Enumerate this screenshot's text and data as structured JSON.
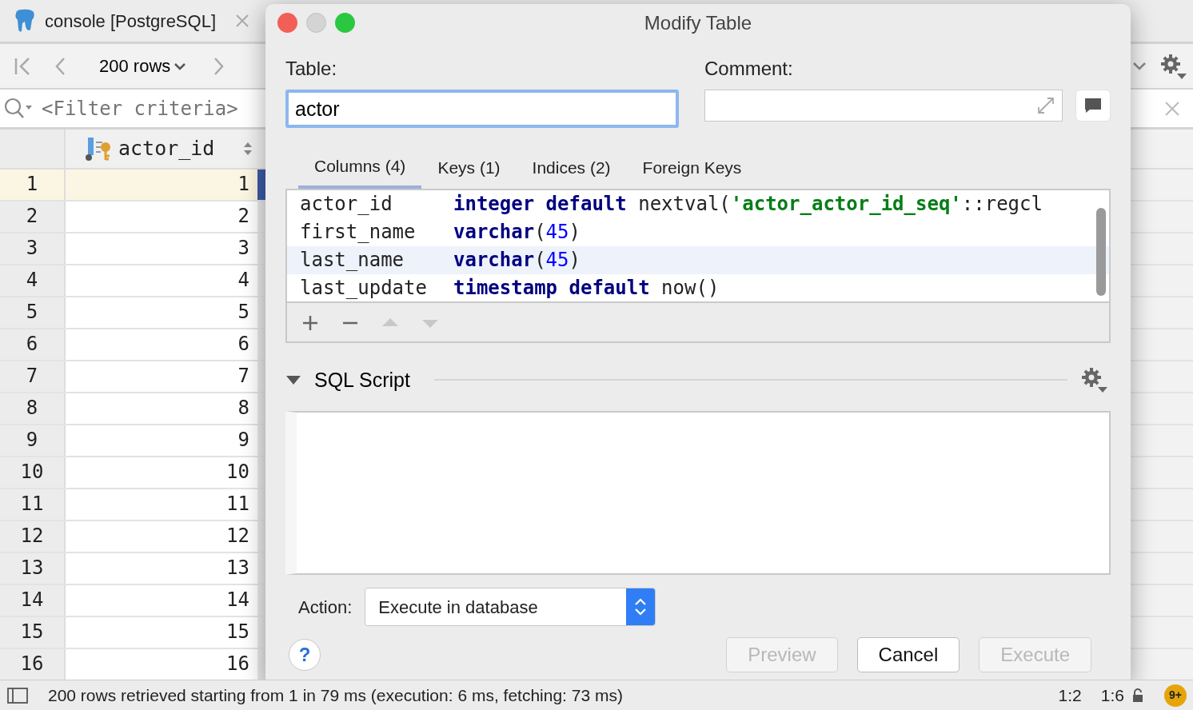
{
  "editor_tab": {
    "title": "console [PostgreSQL]"
  },
  "toolbar": {
    "page_size": "200 rows"
  },
  "filter": {
    "placeholder": "<Filter criteria>"
  },
  "grid": {
    "column": "actor_id",
    "rows": [
      {
        "number": "1",
        "value": "1",
        "selected": true
      },
      {
        "number": "2",
        "value": "2",
        "selected": false
      },
      {
        "number": "3",
        "value": "3",
        "selected": false
      },
      {
        "number": "4",
        "value": "4",
        "selected": false
      },
      {
        "number": "5",
        "value": "5",
        "selected": false
      },
      {
        "number": "6",
        "value": "6",
        "selected": false
      },
      {
        "number": "7",
        "value": "7",
        "selected": false
      },
      {
        "number": "8",
        "value": "8",
        "selected": false
      },
      {
        "number": "9",
        "value": "9",
        "selected": false
      },
      {
        "number": "10",
        "value": "10",
        "selected": false
      },
      {
        "number": "11",
        "value": "11",
        "selected": false
      },
      {
        "number": "12",
        "value": "12",
        "selected": false
      },
      {
        "number": "13",
        "value": "13",
        "selected": false
      },
      {
        "number": "14",
        "value": "14",
        "selected": false
      },
      {
        "number": "15",
        "value": "15",
        "selected": false
      },
      {
        "number": "16",
        "value": "16",
        "selected": false
      }
    ]
  },
  "status_bar": {
    "message": "200 rows retrieved starting from 1 in 79 ms (execution: 6 ms, fetching: 73 ms)",
    "position": "1:2",
    "selection": "1:6",
    "notifications": "9+"
  },
  "dialog": {
    "title": "Modify Table",
    "table_label": "Table:",
    "table_name": "actor",
    "comment_label": "Comment:",
    "tabs": [
      {
        "label": "Columns (4)",
        "selected": true
      },
      {
        "label": "Keys (1)",
        "selected": false
      },
      {
        "label": "Indices (2)",
        "selected": false
      },
      {
        "label": "Foreign Keys",
        "selected": false
      }
    ],
    "columns": [
      {
        "name": "actor_id",
        "selected": false,
        "definition": [
          {
            "text": "integer default",
            "kind": "keyword"
          },
          {
            "text": " nextval(",
            "kind": "plain"
          },
          {
            "text": "'actor_actor_id_seq'",
            "kind": "string"
          },
          {
            "text": "::regcl",
            "kind": "plain"
          }
        ]
      },
      {
        "name": "first_name",
        "selected": false,
        "definition": [
          {
            "text": "varchar",
            "kind": "keyword"
          },
          {
            "text": "(",
            "kind": "plain"
          },
          {
            "text": "45",
            "kind": "number"
          },
          {
            "text": ")",
            "kind": "plain"
          }
        ]
      },
      {
        "name": "last_name",
        "selected": true,
        "definition": [
          {
            "text": "varchar",
            "kind": "keyword"
          },
          {
            "text": "(",
            "kind": "plain"
          },
          {
            "text": "45",
            "kind": "number"
          },
          {
            "text": ")",
            "kind": "plain"
          }
        ]
      },
      {
        "name": "last_update",
        "selected": false,
        "definition": [
          {
            "text": "timestamp default",
            "kind": "keyword"
          },
          {
            "text": " now()",
            "kind": "plain"
          }
        ]
      }
    ],
    "tools": [
      {
        "kind": "add",
        "disabled": false
      },
      {
        "kind": "remove",
        "disabled": false
      },
      {
        "kind": "up",
        "disabled": true
      },
      {
        "kind": "down",
        "disabled": true
      }
    ],
    "sql_script": {
      "title": "SQL Script",
      "expanded": true
    },
    "action": {
      "label": "Action:",
      "value": "Execute in database"
    },
    "help": "?",
    "buttons": [
      {
        "label": "Preview",
        "disabled": true
      },
      {
        "label": "Cancel",
        "disabled": false
      },
      {
        "label": "Execute",
        "disabled": true
      }
    ]
  }
}
